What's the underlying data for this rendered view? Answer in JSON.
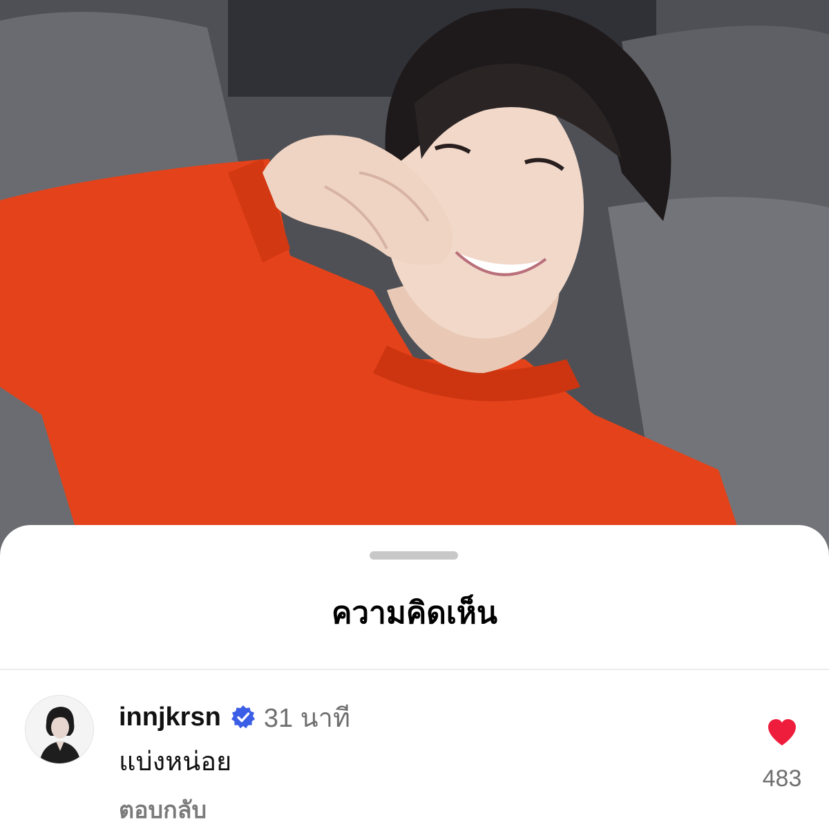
{
  "sheet": {
    "title": "ความคิดเห็น"
  },
  "comment": {
    "username": "innjkrsn",
    "verified": true,
    "timestamp": "31 นาที",
    "text": "แบ่งหน่อย",
    "reply_label": "ตอบกลับ",
    "like_count": "483",
    "liked": true
  },
  "colors": {
    "like_heart": "#ee1d3c",
    "verified_badge": "#3b5ee6",
    "sweater": "#e4421a",
    "sofa": "#55565b"
  }
}
